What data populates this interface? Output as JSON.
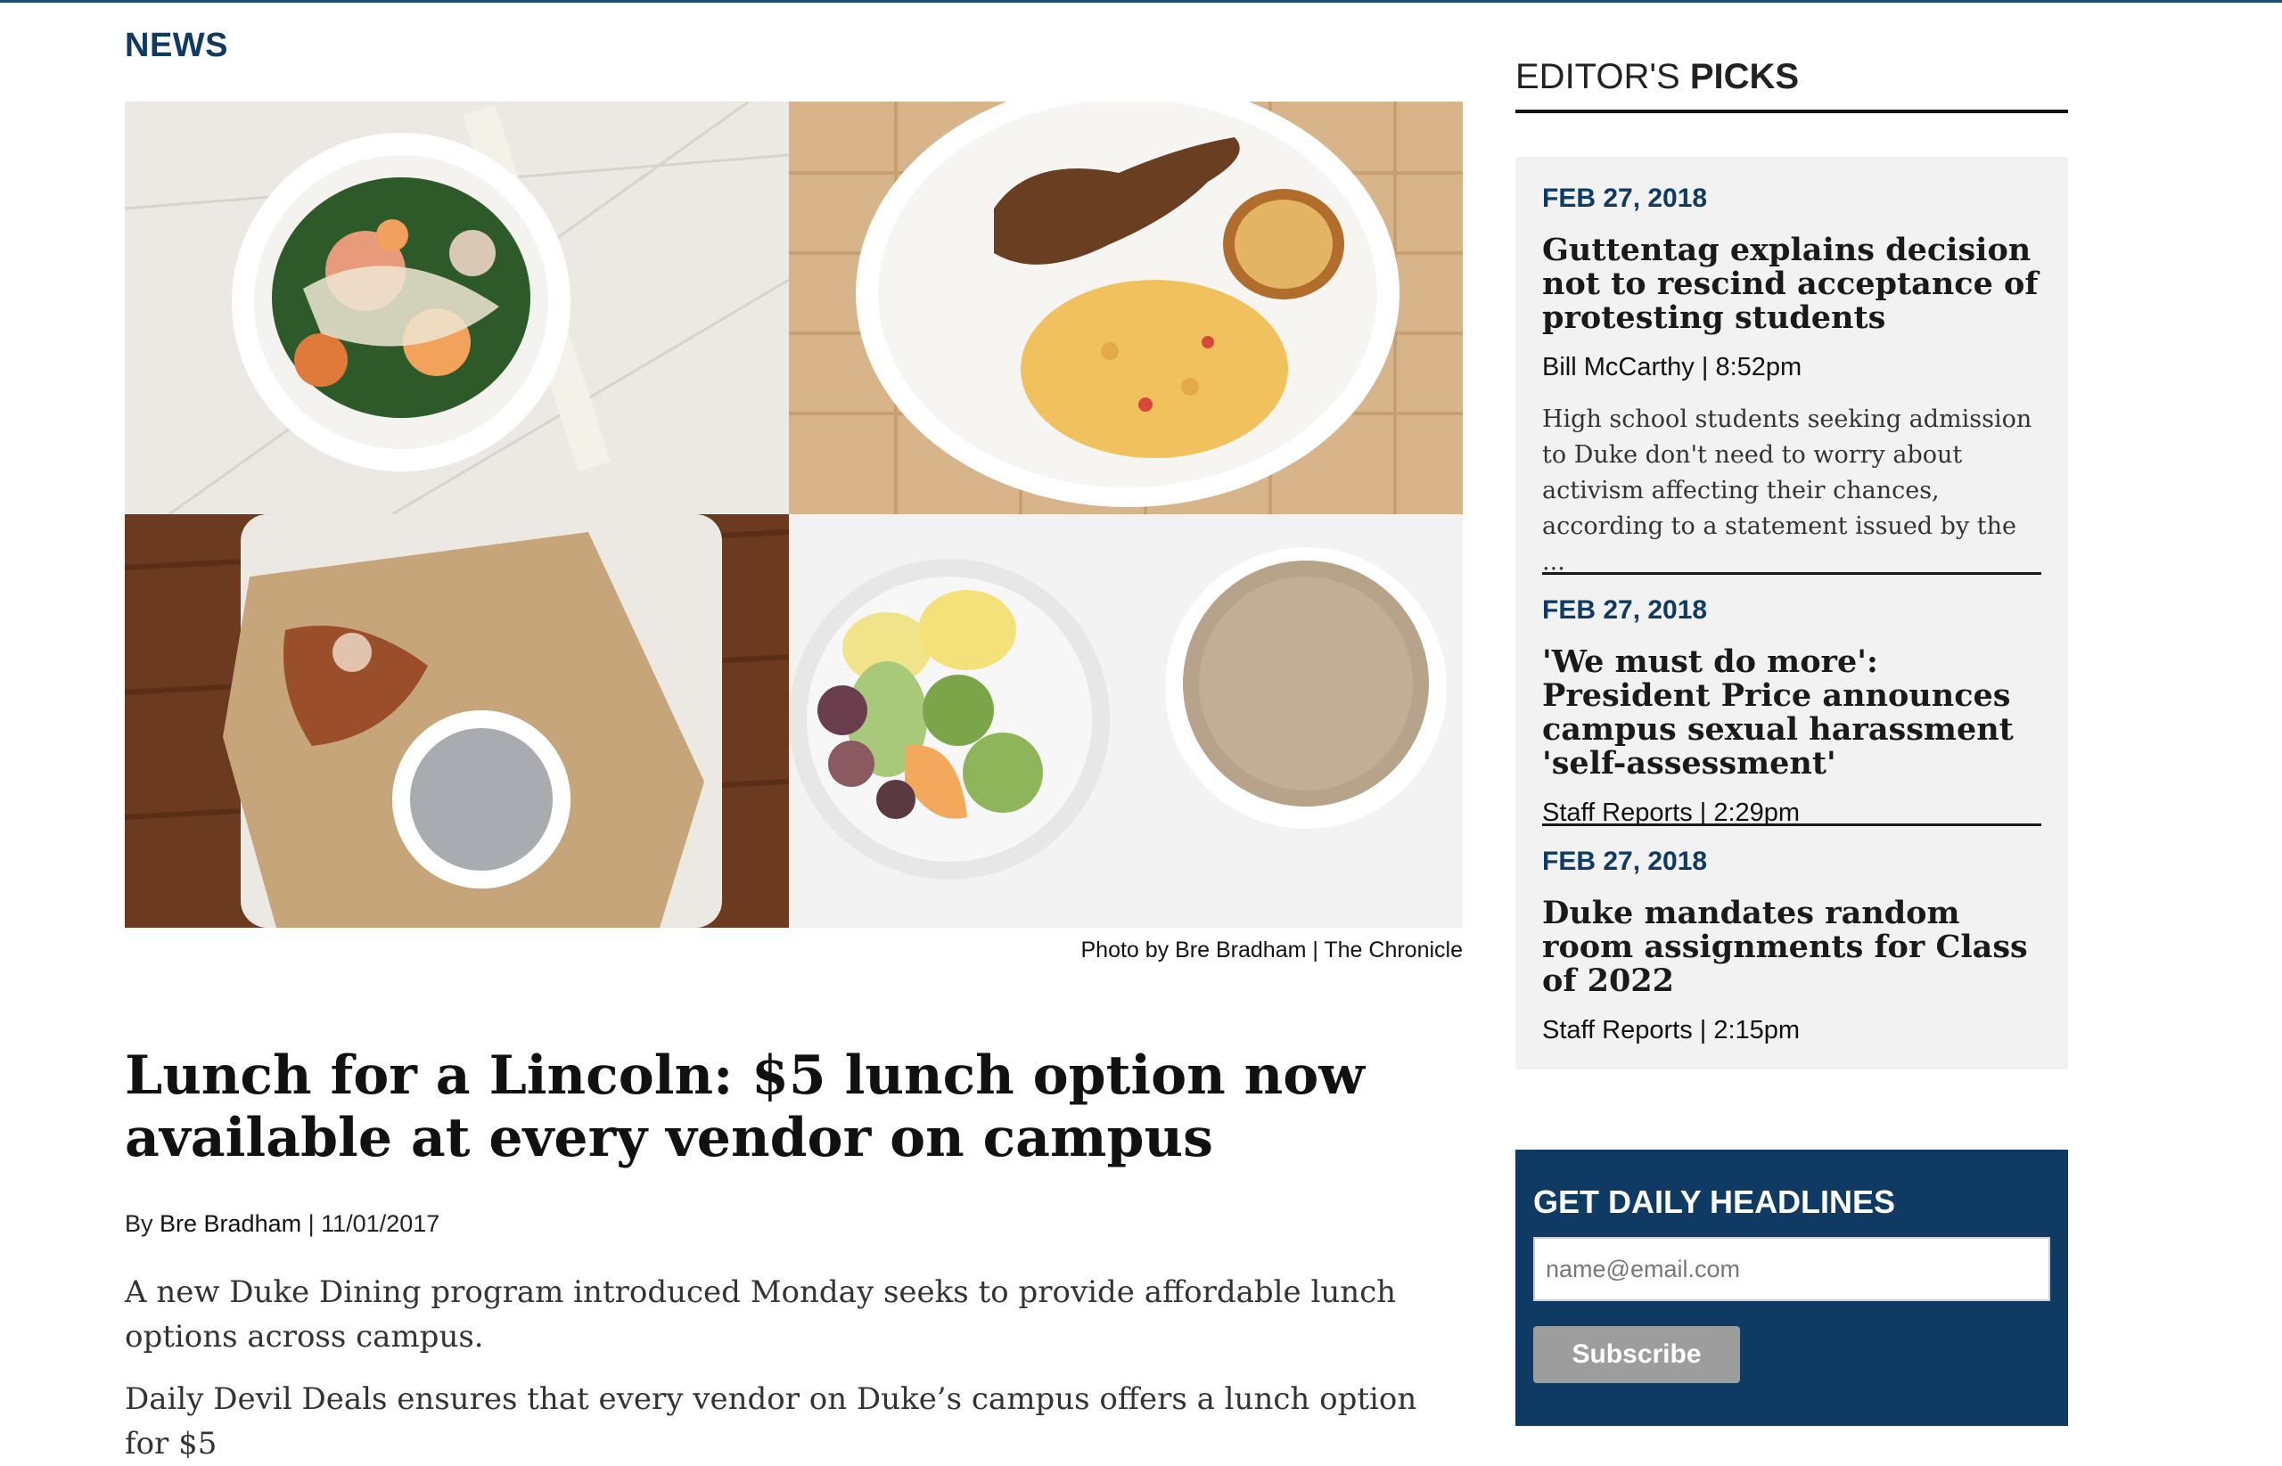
{
  "section": "NEWS",
  "photo": {
    "caption_credit": "Photo by Bre Bradham",
    "caption_sep": " | ",
    "caption_source": "The Chronicle"
  },
  "article": {
    "headline": "Lunch for a Lincoln: $5 lunch option now available at every vendor on campus",
    "by_prefix": "By ",
    "author": "Bre Bradham",
    "date_sep": " | ",
    "date": "11/01/2017",
    "paragraphs": [
      "A new Duke Dining program introduced Monday seeks to provide affordable lunch options across campus.",
      "Daily Devil Deals ensures that every vendor on Duke’s campus offers a lunch option for $5"
    ]
  },
  "editors_picks": {
    "title_prefix": "EDITOR'S ",
    "title_bold": "PICKS",
    "items": [
      {
        "date": "FEB 27, 2018",
        "title": "Guttentag explains decision not to rescind acceptance of protesting students",
        "meta": "Bill McCarthy | 8:52pm",
        "excerpt": "High school students seeking admission to Duke don't need to worry about activism affecting their chances, according to a statement issued by the ..."
      },
      {
        "date": "FEB 27, 2018",
        "title": "'We must do more': President Price announces campus sexual harassment 'self-assessment'",
        "meta": "Staff Reports | 2:29pm"
      },
      {
        "date": "FEB 27, 2018",
        "title": "Duke mandates random room assignments for Class of 2022",
        "meta": "Staff Reports | 2:15pm"
      }
    ]
  },
  "newsletter": {
    "title": "GET DAILY HEADLINES",
    "email_placeholder": "name@email.com",
    "subscribe_label": "Subscribe"
  },
  "colors": {
    "brand_navy": "#0e3a64",
    "sidebar_bg": "#f2f2f2",
    "button_gray": "#9d9d9d"
  }
}
